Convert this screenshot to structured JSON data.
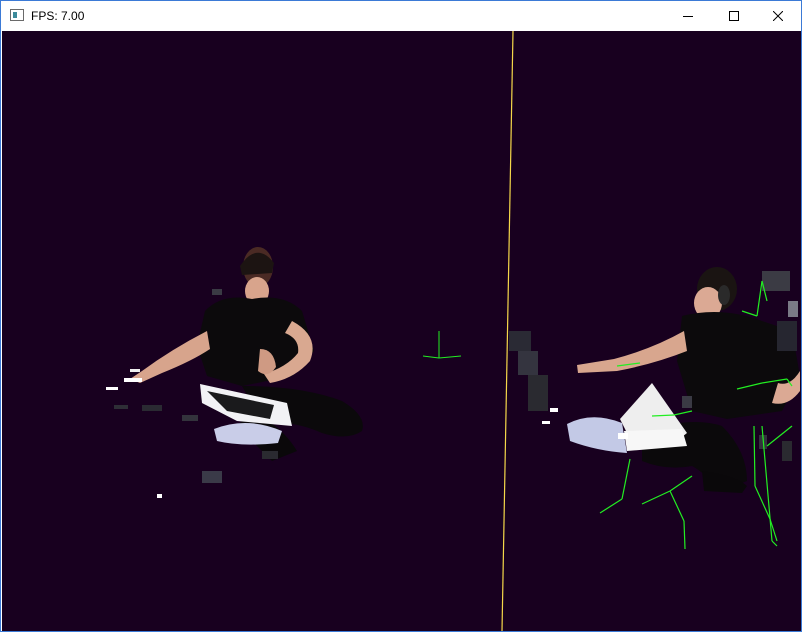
{
  "window": {
    "title": "FPS: 7.00"
  },
  "icons": {
    "app": "app-window-icon",
    "minimize": "minimize-icon",
    "maximize": "maximize-icon",
    "close": "close-icon"
  },
  "colors": {
    "background": "#18001f",
    "divider": "#ffdd33",
    "skeleton": "#22ee22",
    "titlebar": "#ffffff",
    "window_border": "#3b7ad6"
  }
}
